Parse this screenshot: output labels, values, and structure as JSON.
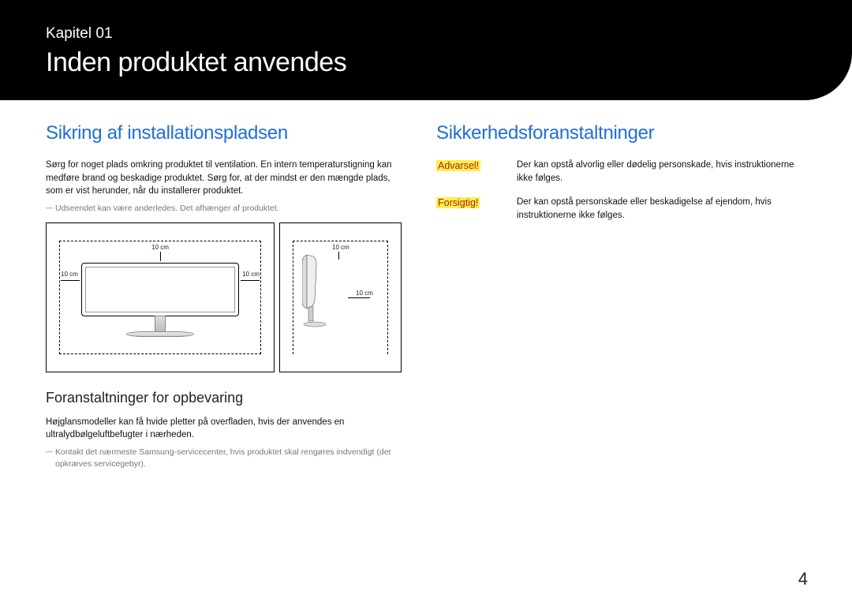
{
  "header": {
    "chapter_label": "Kapitel 01",
    "chapter_title": "Inden produktet anvendes"
  },
  "left": {
    "section_heading": "Sikring af installationspladsen",
    "intro": "Sørg for noget plads omkring produktet til ventilation. En intern temperaturstigning kan medføre brand og beskadige produktet. Sørg for, at der mindst er den mængde plads, som er vist herunder, når du installerer produktet.",
    "note1": "Udseendet kan være anderledes. Det afhænger af produktet.",
    "dims": {
      "top": "10 cm",
      "left": "10 cm",
      "right": "10 cm",
      "side_top": "10 cm",
      "side_back": "10 cm"
    },
    "subheading": "Foranstaltninger for opbevaring",
    "storage_text": "Højglansmodeller kan få hvide pletter på overfladen, hvis der anvendes en ultralydbølgeluftbefugter i nærheden.",
    "note2": "Kontakt det nærmeste Samsung-servicecenter, hvis produktet skal rengøres indvendigt (der opkræves servicegebyr)."
  },
  "right": {
    "section_heading": "Sikkerhedsforanstaltninger",
    "rows": [
      {
        "label": "Advarsel!",
        "desc": "Der kan opstå alvorlig eller dødelig personskade, hvis instruktionerne ikke følges."
      },
      {
        "label": "Forsigtig!",
        "desc": "Der kan opstå personskade eller beskadigelse af ejendom, hvis instruktionerne ikke følges."
      }
    ]
  },
  "page_number": "4"
}
